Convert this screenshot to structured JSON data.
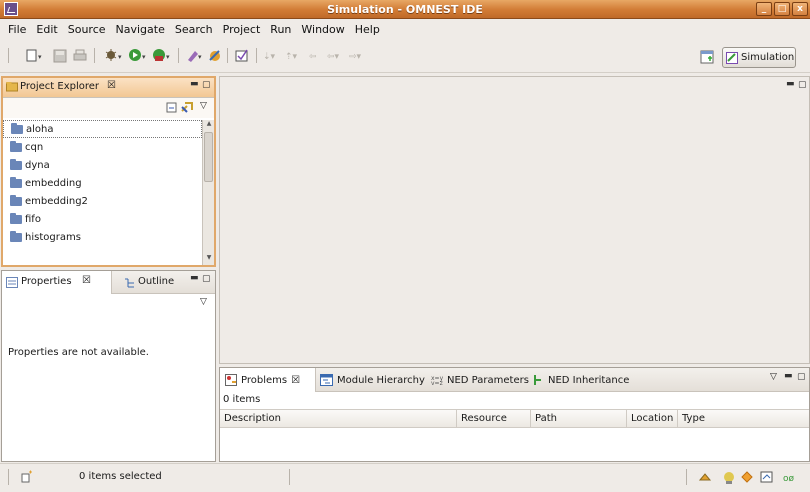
{
  "window": {
    "title": "Simulation - OMNEST IDE"
  },
  "menu": [
    "File",
    "Edit",
    "Source",
    "Navigate",
    "Search",
    "Project",
    "Run",
    "Window",
    "Help"
  ],
  "perspective": {
    "label": "Simulation"
  },
  "project_explorer": {
    "title": "Project Explorer",
    "items": [
      "aloha",
      "cqn",
      "dyna",
      "embedding",
      "embedding2",
      "fifo",
      "histograms"
    ]
  },
  "properties": {
    "tab_label": "Properties",
    "outline_label": "Outline",
    "message": "Properties are not available."
  },
  "problems": {
    "tabs": [
      "Problems",
      "Module Hierarchy",
      "NED Parameters",
      "NED Inheritance"
    ],
    "count": "0 items",
    "columns": [
      "Description",
      "Resource",
      "Path",
      "Location",
      "Type"
    ]
  },
  "status": {
    "text": "0 items selected"
  },
  "colors": {
    "title_bar": "#d17b35",
    "active_panel_border": "#e0a86a",
    "folder": "#6a86b8"
  },
  "icons": [
    "app-icon",
    "new-icon",
    "save-icon",
    "print-icon",
    "debug-icon",
    "run-icon",
    "external-tools-icon",
    "ned-icon",
    "open-icon",
    "task-icon",
    "back-icon",
    "forward-icon",
    "perspective-icon",
    "simulation-perspective-icon",
    "folder-icon",
    "close-icon",
    "minimize-icon",
    "maximize-icon",
    "view-menu-icon",
    "collapse-all-icon",
    "link-editor-icon"
  ]
}
